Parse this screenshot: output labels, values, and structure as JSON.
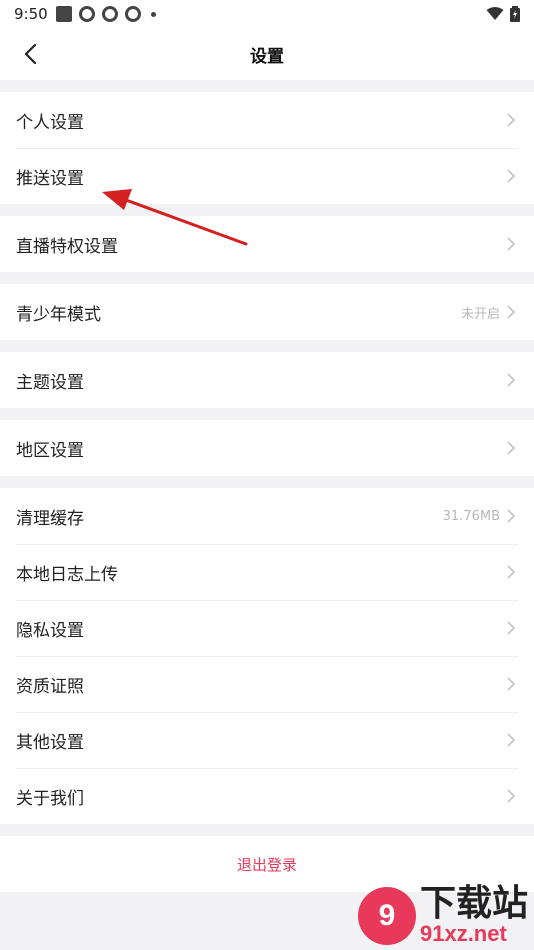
{
  "status_bar": {
    "time": "9:50"
  },
  "header": {
    "title": "设置"
  },
  "groups": [
    {
      "items": [
        {
          "label": "个人设置"
        },
        {
          "label": "推送设置"
        }
      ]
    },
    {
      "items": [
        {
          "label": "直播特权设置"
        }
      ]
    },
    {
      "items": [
        {
          "label": "青少年模式",
          "value": "未开启"
        }
      ]
    },
    {
      "items": [
        {
          "label": "主题设置"
        }
      ]
    },
    {
      "items": [
        {
          "label": "地区设置"
        }
      ]
    },
    {
      "items": [
        {
          "label": "清理缓存",
          "value": "31.76MB"
        },
        {
          "label": "本地日志上传"
        },
        {
          "label": "隐私设置"
        },
        {
          "label": "资质证照"
        },
        {
          "label": "其他设置"
        },
        {
          "label": "关于我们"
        }
      ]
    }
  ],
  "logout": {
    "label": "退出登录"
  },
  "colors": {
    "accent": "#e8395a",
    "background": "#f2f2f4",
    "annotation_arrow": "#d42020"
  },
  "icons": {
    "back": "back-arrow-icon",
    "chevron": "chevron-right-icon"
  },
  "watermark": {
    "logo_text": "9",
    "title": "下载站",
    "url": "91xz.net"
  }
}
